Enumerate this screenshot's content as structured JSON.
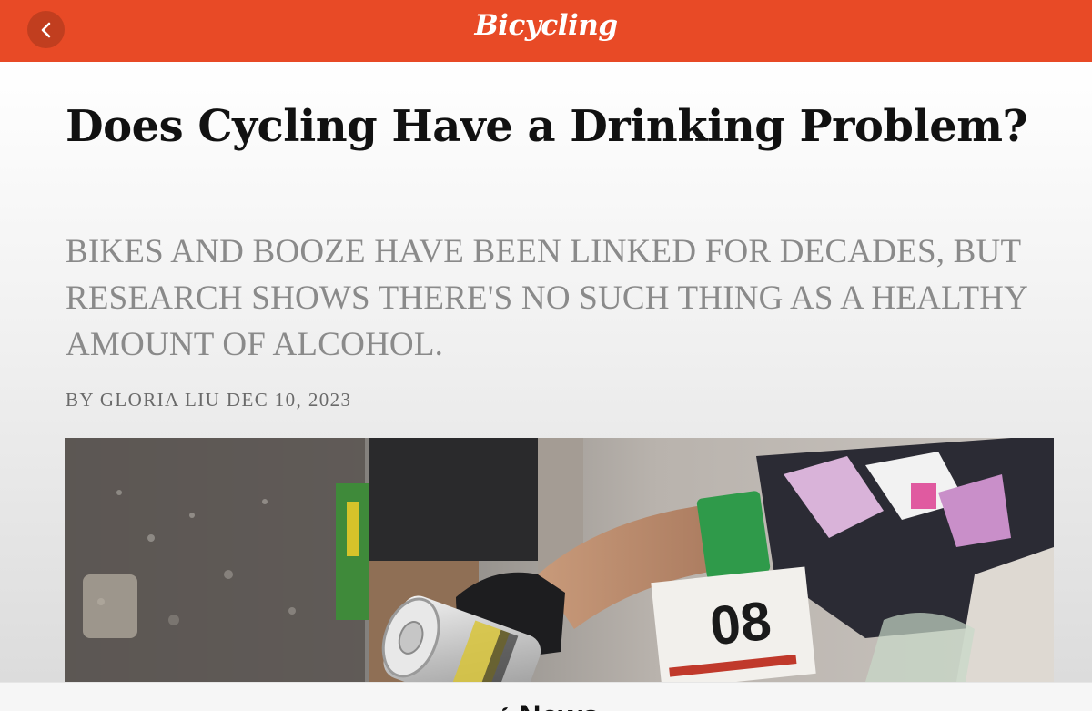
{
  "header": {
    "brand": "Bicycling",
    "back_icon": "chevron-left-icon",
    "bar_color": "#e84a26"
  },
  "article": {
    "headline": "Does Cycling Have a Drinking Problem?",
    "dek": "BIKES AND BOOZE HAVE BEEN LINKED FOR DECADES, BUT RESEARCH SHOWS THERE'S NO SUCH THING AS A HEALTHY AMOUNT OF ALCOHOL.",
    "byline": "BY GLORIA LIU DEC 10, 2023",
    "hero_image": "cyclist-with-beer-can-photo"
  },
  "footer": {
    "logo_label": "News",
    "logo_icon": "apple-icon"
  }
}
